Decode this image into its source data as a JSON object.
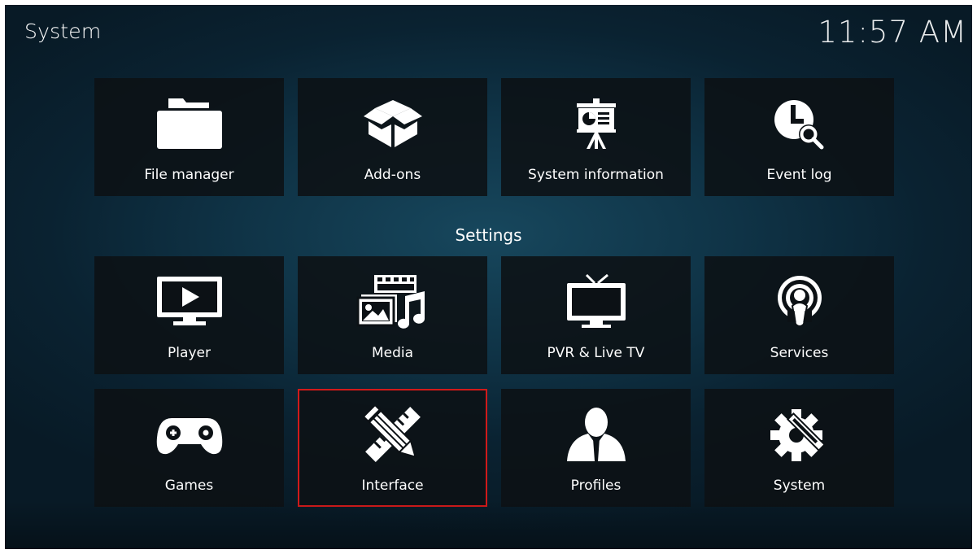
{
  "header": {
    "title": "System",
    "clock": "11:57 AM"
  },
  "settings_label": "Settings",
  "colors": {
    "focus_border": "#d11a1a",
    "tile_bg": "#0c1115",
    "text": "#ffffff"
  },
  "top_tiles": [
    {
      "label": "File manager",
      "icon": "folder-icon"
    },
    {
      "label": "Add-ons",
      "icon": "open-box-icon"
    },
    {
      "label": "System information",
      "icon": "presentation-board-icon"
    },
    {
      "label": "Event log",
      "icon": "clock-search-icon"
    }
  ],
  "settings_tiles": [
    {
      "label": "Player",
      "icon": "monitor-play-icon"
    },
    {
      "label": "Media",
      "icon": "media-library-icon"
    },
    {
      "label": "PVR & Live TV",
      "icon": "tv-antenna-icon"
    },
    {
      "label": "Services",
      "icon": "broadcast-icon"
    },
    {
      "label": "Games",
      "icon": "gamepad-icon"
    },
    {
      "label": "Interface",
      "icon": "pencil-ruler-icon"
    },
    {
      "label": "Profiles",
      "icon": "user-silhouette-icon"
    },
    {
      "label": "System",
      "icon": "gear-wrench-icon"
    }
  ],
  "focused_tile": "Interface"
}
